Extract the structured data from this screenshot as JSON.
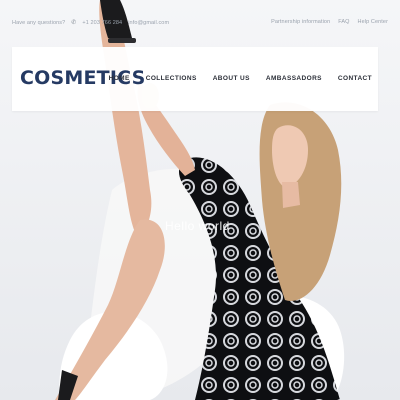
{
  "topbar": {
    "question": "Have any questions?",
    "phone": "+1 203 766 284",
    "email": "info@gmail.com",
    "links": [
      "Partnership information",
      "FAQ",
      "Help Center"
    ]
  },
  "header": {
    "logo": "COSMETICS",
    "nav": [
      "HOME",
      "COLLECTIONS",
      "ABOUT US",
      "AMBASSADORS",
      "CONTACT"
    ]
  },
  "hero": {
    "headline": "Hello world"
  },
  "colors": {
    "logo": "#253a63",
    "background": "#f2f3f5",
    "nav_text": "#2b2f38",
    "topbar_text": "#9aa2ad"
  },
  "icons": {
    "phone": "phone-icon"
  }
}
